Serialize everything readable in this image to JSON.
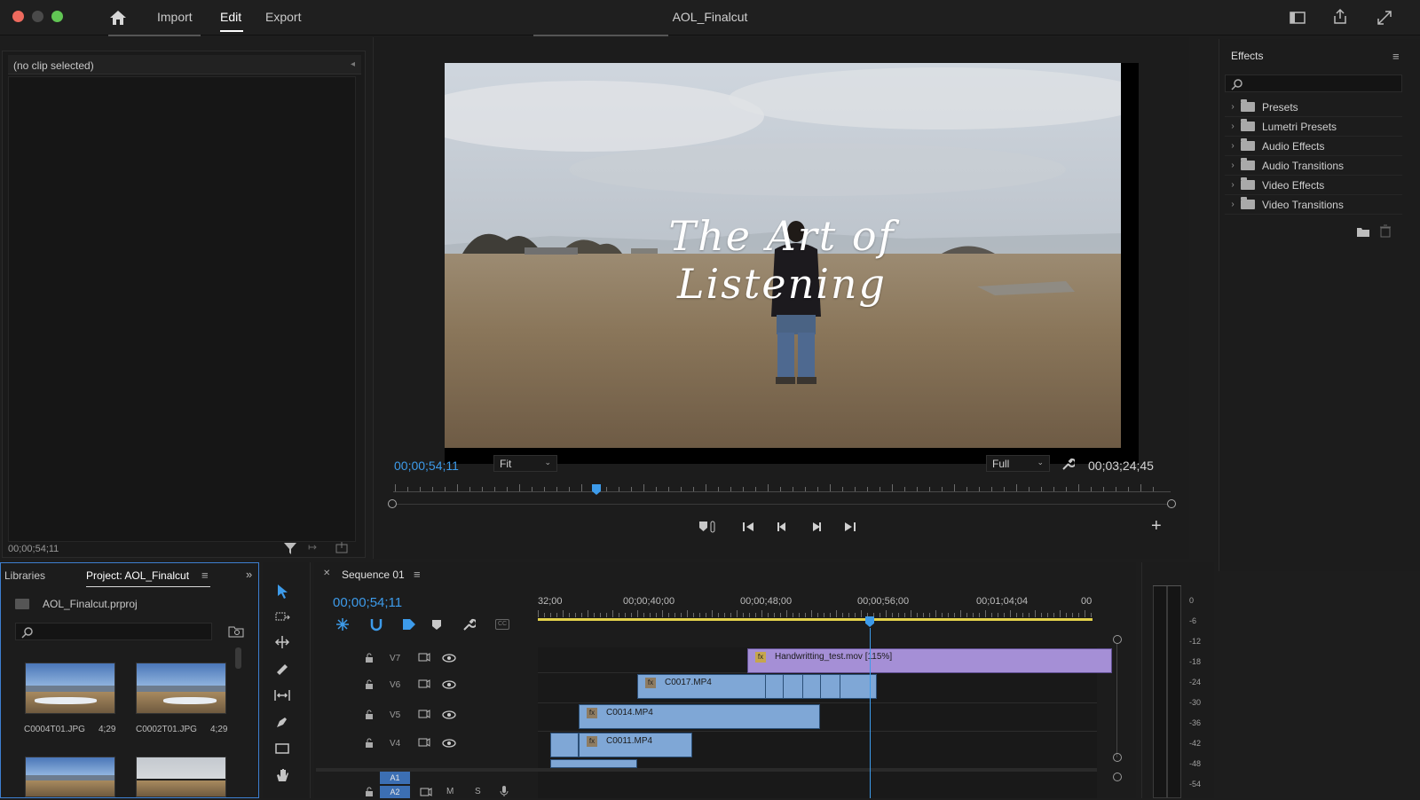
{
  "app": {
    "title": "AOL_Finalcut",
    "tabs": [
      "Import",
      "Edit",
      "Export"
    ],
    "active_tab": "Edit"
  },
  "source": {
    "no_clip": "(no clip selected)",
    "timecode": "00;00;54;11"
  },
  "program": {
    "title_overlay": "The Art of Listening",
    "timecode_current": "00;00;54;11",
    "zoom": "Fit",
    "quality": "Full",
    "duration": "00;03;24;45"
  },
  "effects": {
    "title": "Effects",
    "search_placeholder": "",
    "folders": [
      "Presets",
      "Lumetri Presets",
      "Audio Effects",
      "Audio Transitions",
      "Video Effects",
      "Video Transitions"
    ]
  },
  "project": {
    "tab_libraries": "Libraries",
    "tab_project": "Project: AOL_Finalcut",
    "file": "AOL_Finalcut.prproj",
    "items": [
      {
        "name": "C0004T01.JPG",
        "duration": "4;29"
      },
      {
        "name": "C0002T01.JPG",
        "duration": "4;29"
      },
      {
        "name": "",
        "duration": ""
      },
      {
        "name": "",
        "duration": ""
      }
    ]
  },
  "sequence": {
    "tab": "Sequence 01",
    "timecode": "00;00;54;11",
    "ruler": [
      "32;00",
      "00;00;40;00",
      "00;00;48;00",
      "00;00;56;00",
      "00;01;04;04",
      "00"
    ],
    "tracks": [
      {
        "label": "V7"
      },
      {
        "label": "V6"
      },
      {
        "label": "V5"
      },
      {
        "label": "V4"
      },
      {
        "label": "A1"
      },
      {
        "label": "A2",
        "m": "M",
        "s": "S"
      }
    ],
    "clips": [
      {
        "name": "Handwritting_test.mov [115%]",
        "fx": "fx"
      },
      {
        "name": "C0017.MP4",
        "fx": "fx"
      },
      {
        "name": "C0014.MP4",
        "fx": "fx"
      },
      {
        "name": "C0011.MP4",
        "fx": "fx"
      }
    ]
  },
  "meter": {
    "labels": [
      "0",
      "-6",
      "-12",
      "-18",
      "-24",
      "-30",
      "-36",
      "-42",
      "-48",
      "-54"
    ]
  },
  "colors": {
    "accent": "#3d9bea",
    "clip_blue": "#7fa7d6",
    "clip_purple": "#a58fd6",
    "work_area": "#e3d24b"
  }
}
